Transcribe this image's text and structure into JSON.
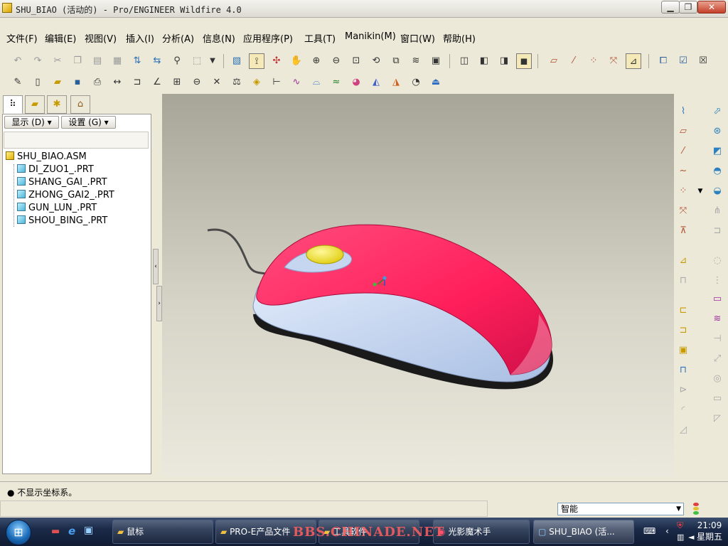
{
  "window": {
    "title": "SHU_BIAO (活动的) - Pro/ENGINEER Wildfire 4.0",
    "minimize_glyph": "▁",
    "maximize_glyph": "❐",
    "close_glyph": "✕"
  },
  "menu": [
    "文件(F)",
    "编辑(E)",
    "视图(V)",
    "插入(I)",
    "分析(A)",
    "信息(N)",
    "应用程序(P)",
    "工具(T)",
    "Manikin(M)",
    "窗口(W)",
    "帮助(H)"
  ],
  "navigator": {
    "display_label": "显示 (D) ▾",
    "settings_label": "设置 (G) ▾",
    "tree": [
      {
        "label": "SHU_BIAO.ASM",
        "type": "asm"
      },
      {
        "label": "DI_ZUO1_.PRT",
        "type": "prt"
      },
      {
        "label": "SHANG_GAI_.PRT",
        "type": "prt"
      },
      {
        "label": "ZHONG_GAI2_.PRT",
        "type": "prt"
      },
      {
        "label": "GUN_LUN_.PRT",
        "type": "prt"
      },
      {
        "label": "SHOU_BING_.PRT",
        "type": "prt"
      }
    ]
  },
  "status": {
    "message": "● 不显示坐标系。"
  },
  "filter": {
    "value": "智能"
  },
  "colors": {
    "mouse_top": "#ff1f5a",
    "mouse_side": "#c6d6f0",
    "wheel": "#f2e21a"
  },
  "taskbar": {
    "tasks": [
      "鼠标",
      "PRO-E产品文件",
      "工具软件",
      "光影魔术手",
      "SHU_BIAO (活..."
    ],
    "time": "21:09",
    "day": "星期五"
  },
  "watermark": "BBS.CHINADE.NET"
}
